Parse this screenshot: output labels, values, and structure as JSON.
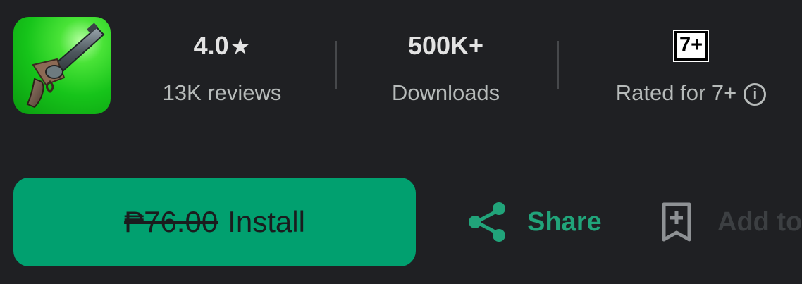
{
  "app": {
    "icon": "revolver-app-icon"
  },
  "stats": {
    "rating_value": "4.0",
    "rating_star": "★",
    "reviews_label": "13K reviews",
    "downloads_value": "500K+",
    "downloads_label": "Downloads",
    "age_badge": "7+",
    "age_label": "Rated for 7+",
    "info_icon": "info-icon",
    "info_glyph": "i"
  },
  "actions": {
    "old_price": "₱76.00",
    "install_label": "Install",
    "share_label": "Share",
    "wishlist_label": "Add to"
  },
  "colors": {
    "background": "#1f2023",
    "install_green": "#01a06f",
    "share_green": "#21a47a"
  }
}
